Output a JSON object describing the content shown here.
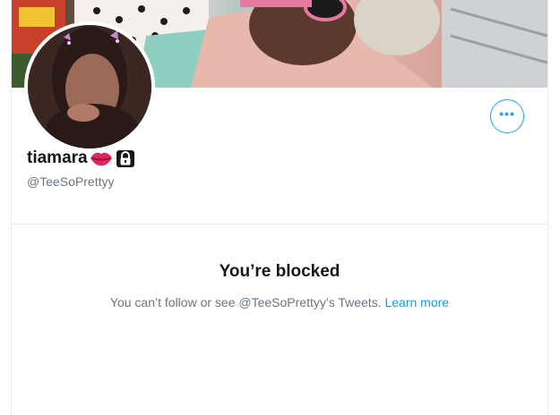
{
  "profile": {
    "name": "tiamara",
    "handle": "@TeeSoPrettyy",
    "name_emoji": "lips-icon",
    "protected_icon": "lock-icon"
  },
  "more_button": {
    "icon": "more-horizontal-icon",
    "label": "•••"
  },
  "blocked": {
    "title": "You’re blocked",
    "message": "You can’t follow or see @TeeSoPrettyy’s Tweets.",
    "link_label": "Learn more"
  },
  "colors": {
    "accent": "#1da1f2",
    "link": "#1b95e0",
    "text_primary": "#14171a",
    "text_secondary": "#657786",
    "border": "#e6ecf0"
  }
}
